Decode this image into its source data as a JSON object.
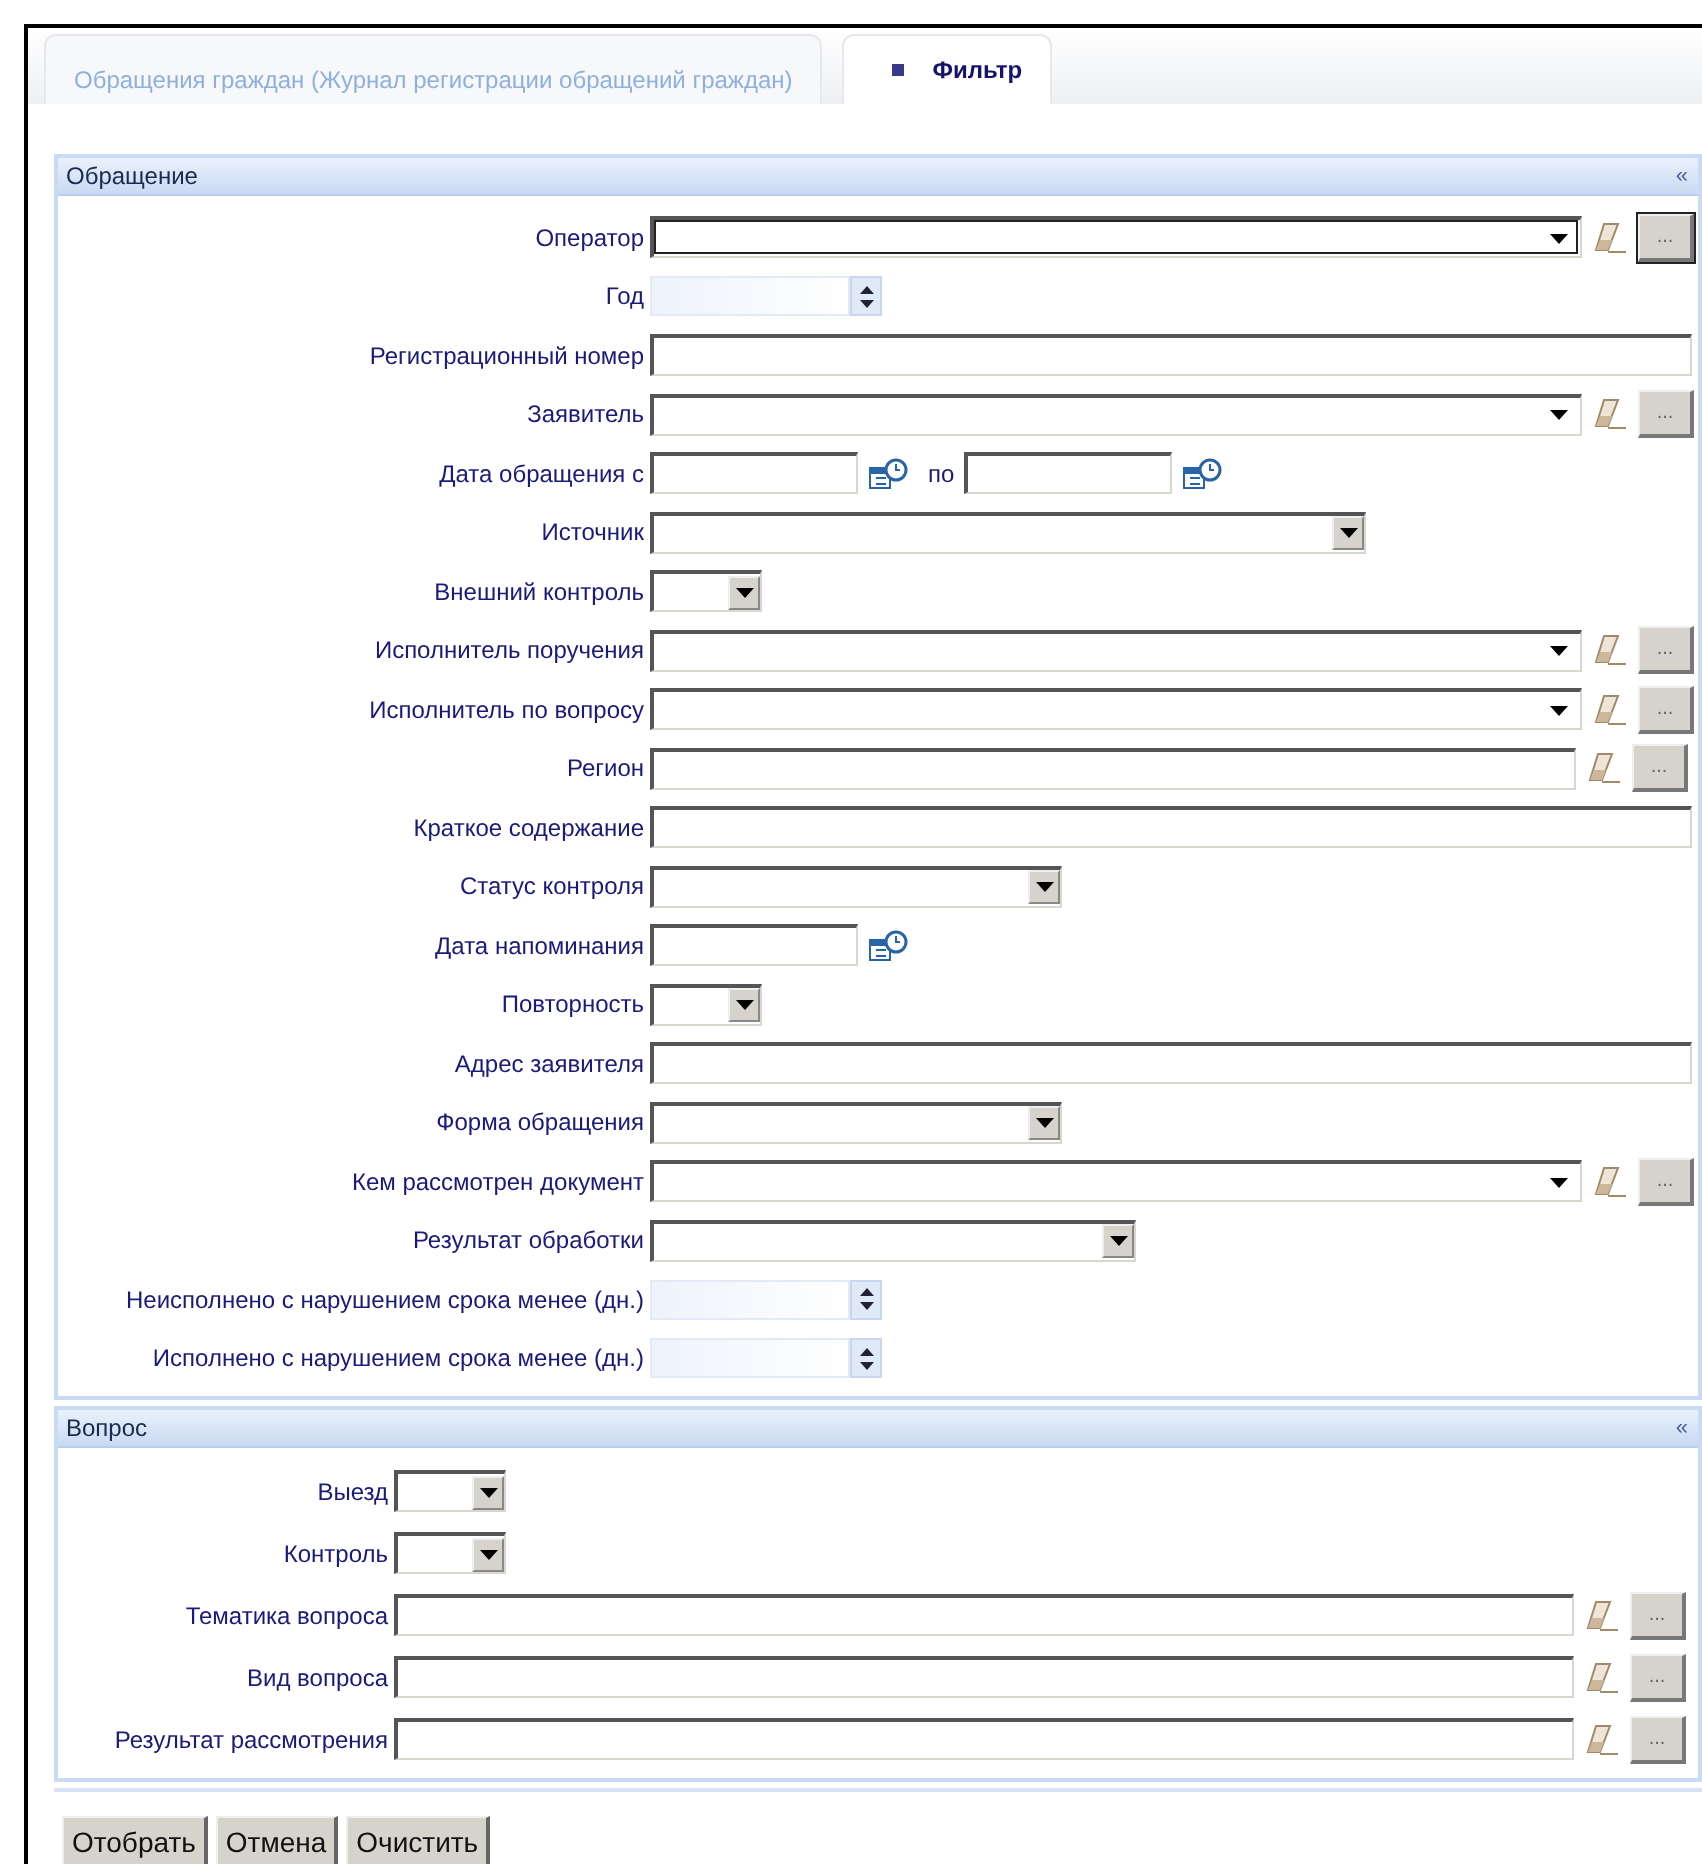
{
  "tabs": [
    {
      "label": "Обращения граждан (Журнал регистрации обращений граждан)",
      "selected": false
    },
    {
      "label": "Фильтр",
      "selected": true
    }
  ],
  "sections": [
    {
      "title": "Обращение",
      "collapse": "«",
      "fields": [
        {
          "label": "Оператор",
          "kind": "combo",
          "browse": "...",
          "focused": true
        },
        {
          "label": "Год",
          "kind": "spinner"
        },
        {
          "label": "Регистрационный номер",
          "kind": "text"
        },
        {
          "label": "Заявитель",
          "kind": "combo",
          "browse": "...",
          "focused": false
        },
        {
          "label": "Дата обращения с",
          "kind": "daterange",
          "between": "по"
        },
        {
          "label": "Источник",
          "kind": "select"
        },
        {
          "label": "Внешний контроль",
          "kind": "select_small"
        },
        {
          "label": "Исполнитель поручения",
          "kind": "combo",
          "browse": "...",
          "focused": false
        },
        {
          "label": "Исполнитель по вопросу",
          "kind": "combo",
          "browse": "...",
          "focused": false
        },
        {
          "label": "Регион",
          "kind": "lookup",
          "browse": "..."
        },
        {
          "label": "Краткое содержание",
          "kind": "text"
        },
        {
          "label": "Статус контроля",
          "kind": "select"
        },
        {
          "label": "Дата напоминания",
          "kind": "date"
        },
        {
          "label": "Повторность",
          "kind": "select_small"
        },
        {
          "label": "Адрес заявителя",
          "kind": "text"
        },
        {
          "label": "Форма обращения",
          "kind": "select"
        },
        {
          "label": "Кем рассмотрен документ",
          "kind": "combo",
          "browse": "...",
          "focused": false
        },
        {
          "label": "Результат обработки",
          "kind": "select"
        },
        {
          "label": "Неисполнено с нарушением срока менее (дн.)",
          "kind": "spinner"
        },
        {
          "label": "Исполнено с нарушением срока менее (дн.)",
          "kind": "spinner"
        }
      ]
    },
    {
      "title": "Вопрос",
      "collapse": "«",
      "fields": [
        {
          "label": "Выезд",
          "kind": "select_small"
        },
        {
          "label": "Контроль",
          "kind": "select_small"
        },
        {
          "label": "Тематика вопроса",
          "kind": "lookup",
          "browse": "..."
        },
        {
          "label": "Вид вопроса",
          "kind": "lookup",
          "browse": "..."
        },
        {
          "label": "Результат рассмотрения",
          "kind": "lookup",
          "browse": "..."
        }
      ]
    }
  ],
  "buttons": [
    "Отобрать",
    "Отмена",
    "Очистить"
  ]
}
